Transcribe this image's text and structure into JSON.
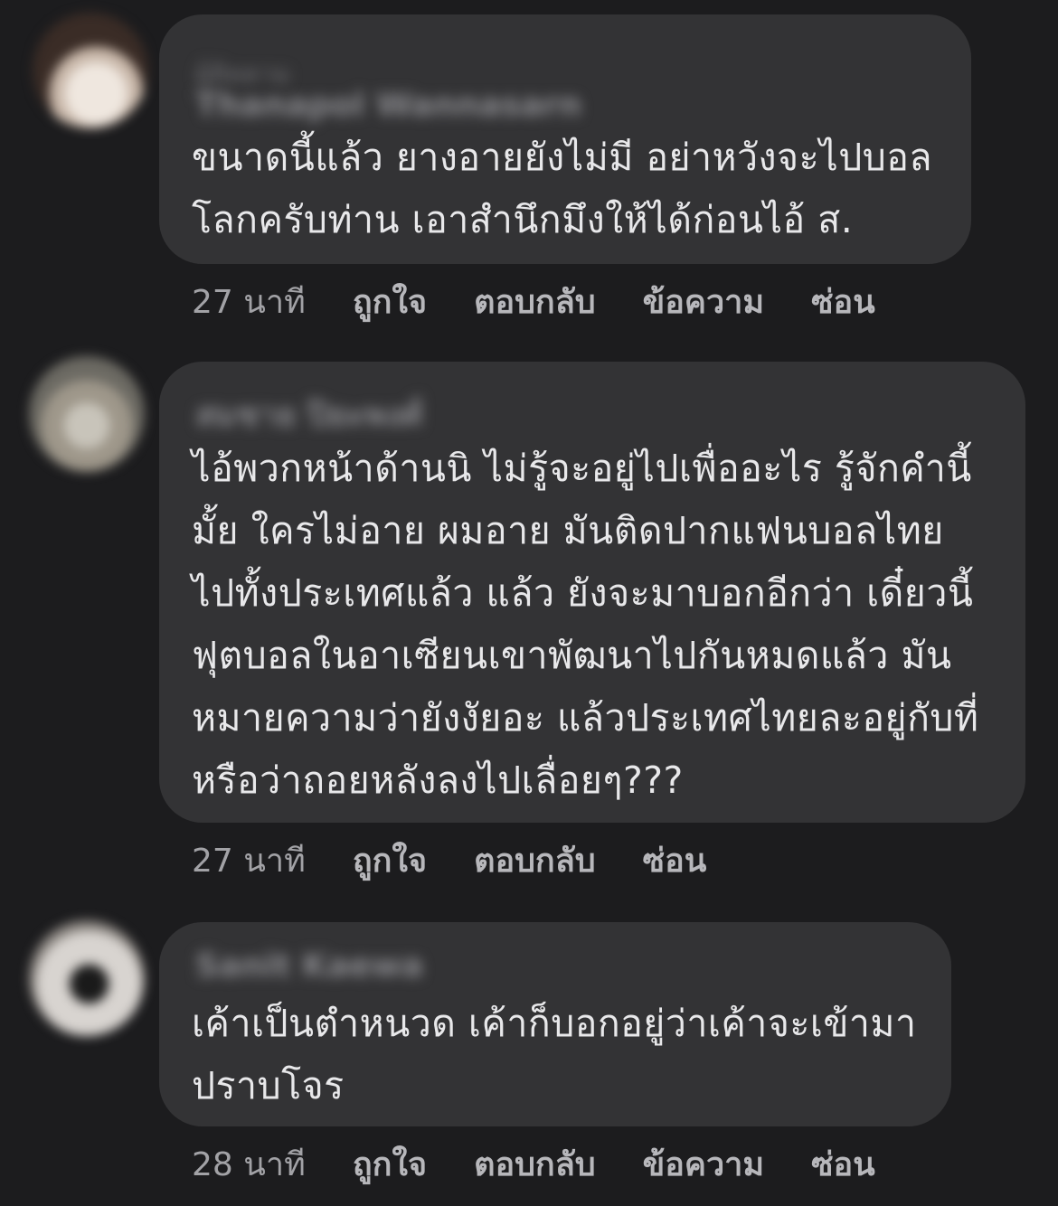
{
  "comments": [
    {
      "author": "Thanapol Wannasarn",
      "subline": "ผู้ติดตาม",
      "text": "ขนาดนี้แล้ว ยางอายยังไม่มี อย่าหวังจะไปบอล\nโลกครับท่าน เอาสำนึกมึงให้ได้ก่อนไอ้ ส.",
      "time": "27 นาที",
      "actions": [
        "ถูกใจ",
        "ตอบกลับ",
        "ข้อความ",
        "ซ่อน"
      ]
    },
    {
      "author": "สมชาย ปิยะพงศ์",
      "text": "ไอ้พวกหน้าด้านนิ ไม่รู้จะอยู่ไปเพื่ออะไร รู้จักคำนี้\nมั้ย ใครไม่อาย ผมอาย มันติดปากแฟนบอลไทย\nไปทั้งประเทศแล้ว แล้ว ยังจะมาบอกอีกว่า เดี๋ยวนี้\nฟุตบอลในอาเซียนเขาพัฒนาไปกันหมดแล้ว มัน\nหมายความว่ายังงัยอะ แล้วประเทศไทยละอยู่กับที่\nหรือว่าถอยหลังลงไปเลื่อยๆ???",
      "time": "27 นาที",
      "actions": [
        "ถูกใจ",
        "ตอบกลับ",
        "ซ่อน"
      ]
    },
    {
      "author": "Sanit Kaewa",
      "text": "เค้าเป็นตำหนวด เค้าก็บอกอยู่ว่าเค้าจะเข้ามา\nปราบโจร",
      "time": "28 นาที",
      "actions": [
        "ถูกใจ",
        "ตอบกลับ",
        "ข้อความ",
        "ซ่อน"
      ]
    }
  ],
  "colors": {
    "background": "#1c1c1e",
    "bubble": "#333335",
    "text": "#e8e8ea",
    "meta": "#b7b7bb"
  }
}
